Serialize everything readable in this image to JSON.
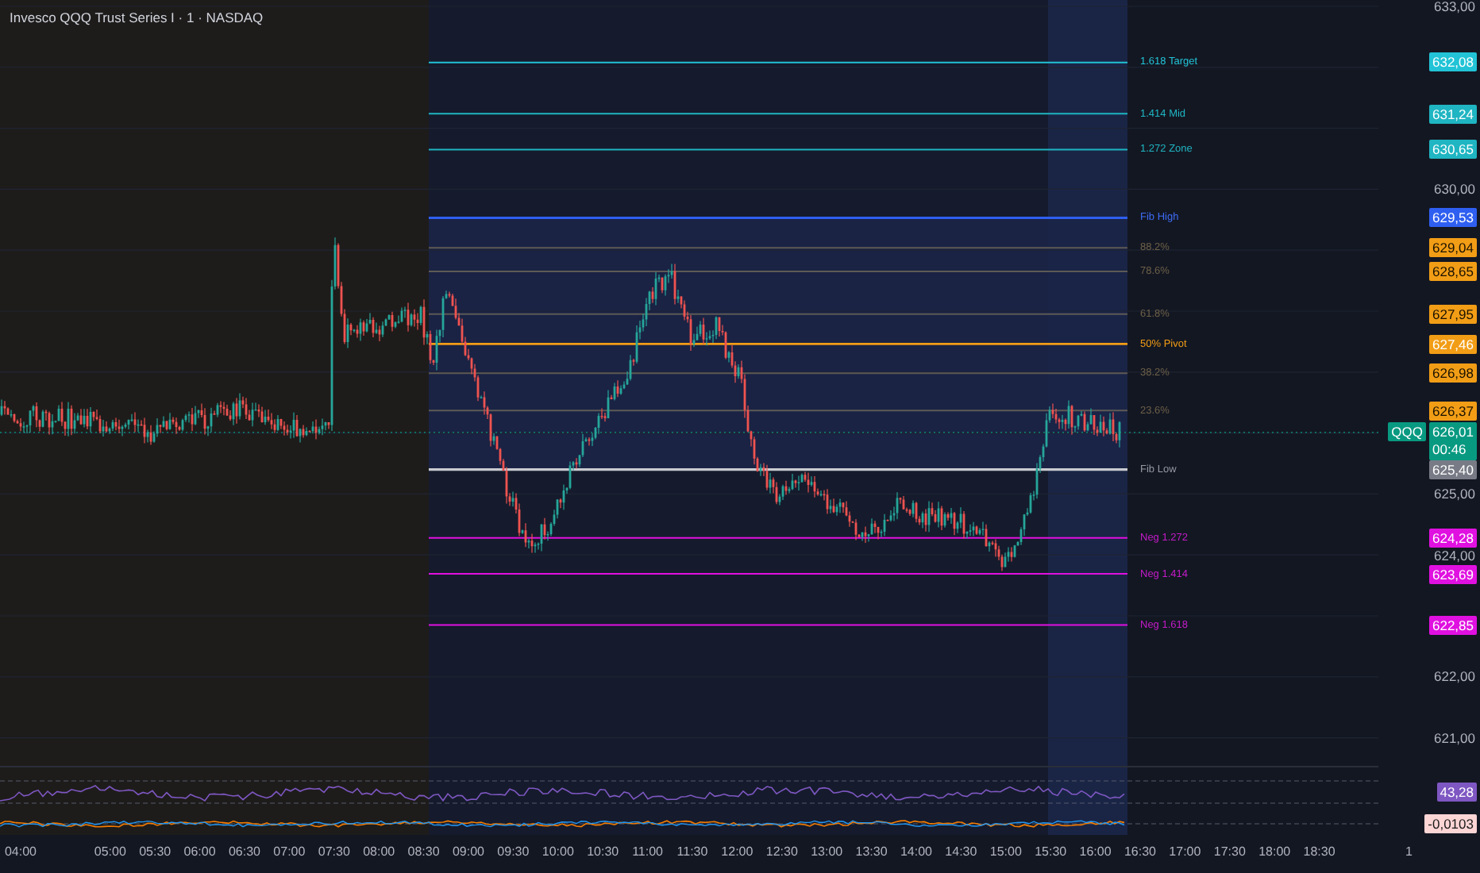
{
  "header": {
    "title": "Invesco QQQ Trust Series I · 1 · NASDAQ"
  },
  "price_axis": {
    "ticks": [
      "633,00",
      "630,00",
      "625,00",
      "624,00",
      "622,00",
      "621,00"
    ]
  },
  "levels": [
    {
      "label": "1.618 Target",
      "price": "632,08",
      "color": "#22c3d6",
      "kind": "extension"
    },
    {
      "label": "1.414 Mid",
      "price": "631,24",
      "color": "#1fb5c2",
      "kind": "extension"
    },
    {
      "label": "1.272 Zone",
      "price": "630,65",
      "color": "#1fb5c2",
      "kind": "extension"
    },
    {
      "label": "Fib High",
      "price": "629,53",
      "color": "#2f5ff0",
      "kind": "bound"
    },
    {
      "label": "88.2%",
      "price": "629,04",
      "color": "#f29d16",
      "kind": "retracement"
    },
    {
      "label": "78.6%",
      "price": "628,65",
      "color": "#f29d16",
      "kind": "retracement"
    },
    {
      "label": "61.8%",
      "price": "627,95",
      "color": "#f29d16",
      "kind": "retracement"
    },
    {
      "label": "50% Pivot",
      "price": "627,46",
      "color": "#f29d16",
      "kind": "pivot"
    },
    {
      "label": "38.2%",
      "price": "626,98",
      "color": "#f29d16",
      "kind": "retracement"
    },
    {
      "label": "23.6%",
      "price": "626,37",
      "color": "#f29d16",
      "kind": "retracement"
    },
    {
      "label": "Fib Low",
      "price": "625,40",
      "color": "#787b86",
      "kind": "bound"
    },
    {
      "label": "Neg 1.272",
      "price": "624,28",
      "color": "#e010e0",
      "kind": "negative"
    },
    {
      "label": "Neg 1.414",
      "price": "623,69",
      "color": "#e010e0",
      "kind": "negative"
    },
    {
      "label": "Neg 1.618",
      "price": "622,85",
      "color": "#e010e0",
      "kind": "negative"
    }
  ],
  "last_price": {
    "symbol": "QQQ",
    "price": "626,01",
    "countdown": "00:46"
  },
  "rsi": {
    "value": "43,28"
  },
  "macd": {
    "value": "-0,0103"
  },
  "time_axis": {
    "labels": [
      "04:00",
      "05:00",
      "05:30",
      "06:00",
      "06:30",
      "07:00",
      "07:30",
      "08:00",
      "08:30",
      "09:00",
      "09:30",
      "10:00",
      "10:30",
      "11:00",
      "11:30",
      "12:00",
      "12:30",
      "13:00",
      "13:30",
      "14:00",
      "14:30",
      "15:00",
      "15:30",
      "16:00",
      "16:30",
      "17:00",
      "17:30",
      "18:00",
      "18:30",
      "1"
    ]
  }
}
